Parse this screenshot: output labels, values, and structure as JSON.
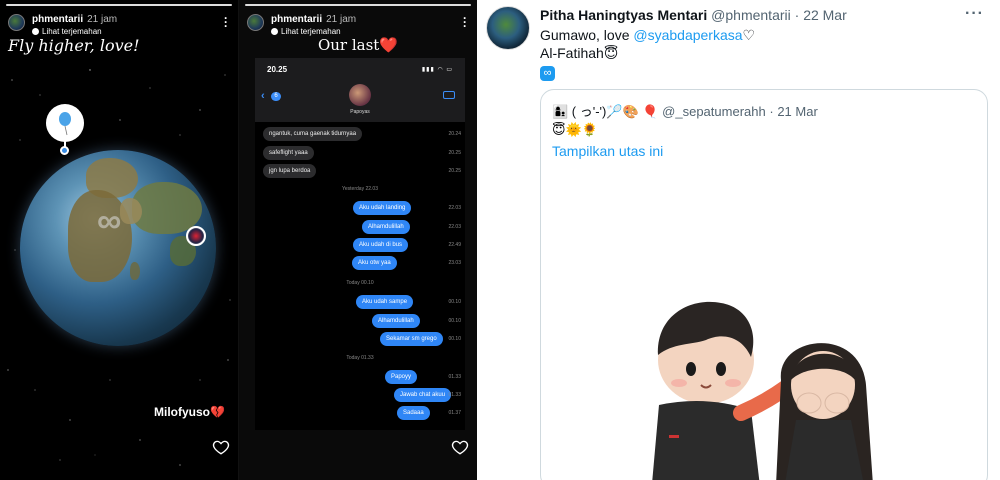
{
  "story1": {
    "username": "phmentarii",
    "time": "21 jam",
    "translate_label": "Lihat terjemahan",
    "caption": "Fly higher, love!",
    "sticker_text": "Milofyuso💔",
    "infinity_symbol": "∞"
  },
  "story2": {
    "username": "phmentarii",
    "time": "21 jam",
    "translate_label": "Lihat terjemahan",
    "caption": "Our last❤️",
    "chat": {
      "status_time": "20.25",
      "back_count": "6",
      "contact_name": "Papoyas",
      "messages": [
        {
          "dir": "in",
          "text": "ngantuk, cuma gaenak tidurnyaa",
          "time": "20.24"
        },
        {
          "dir": "in",
          "text": "safeflight yaaa",
          "time": "20.25"
        },
        {
          "dir": "in",
          "text": "jgn lupa berdoa",
          "time": "20.25"
        },
        {
          "dir": "sep",
          "text": "Yesterday 22.03"
        },
        {
          "dir": "out",
          "text": "Aku udah landing",
          "time": "22.03"
        },
        {
          "dir": "out",
          "text": "Alhamdulillah",
          "time": "22.03"
        },
        {
          "dir": "out",
          "text": "Aku udah di bus",
          "time": "22.49"
        },
        {
          "dir": "out",
          "text": "Aku otw yaa",
          "time": "23.03"
        },
        {
          "dir": "sep",
          "text": "Today 00.10"
        },
        {
          "dir": "out",
          "text": "Aku udah sampe",
          "time": "00.10"
        },
        {
          "dir": "out",
          "text": "Alhamdulillah",
          "time": "00.10"
        },
        {
          "dir": "out",
          "text": "Sekamar sm grego",
          "time": "00.10"
        },
        {
          "dir": "sep",
          "text": "Today 01.33"
        },
        {
          "dir": "out",
          "text": "Papoyy",
          "time": "01.33"
        },
        {
          "dir": "out",
          "text": "Jawab chat akuu",
          "time": "01.33"
        },
        {
          "dir": "out",
          "text": "Sadaaa",
          "time": "01.37"
        }
      ]
    }
  },
  "tweet": {
    "name": "Pitha Haningtyas Mentari",
    "handle": "@phmentarii",
    "dot": "·",
    "date": "22 Mar",
    "line1_text": "Gumawo, love ",
    "line1_mention": "@syabdaperkasa",
    "line1_suffix": "♡",
    "line2": "Al-Fatihah😇",
    "line3_icon": "∞",
    "more": "···",
    "quote": {
      "display": "👩‍👦 ( っ'-')🏸🎨 🎈",
      "handle": "@_sepatumerahh",
      "dot": "·",
      "date": "21 Mar",
      "emojis": "😇🌞🌻",
      "show_thread": "Tampilkan utas ini"
    }
  },
  "colors": {
    "accent": "#1d9bf0",
    "imessage_blue": "#2f86f6",
    "story_bg": "#000000"
  }
}
